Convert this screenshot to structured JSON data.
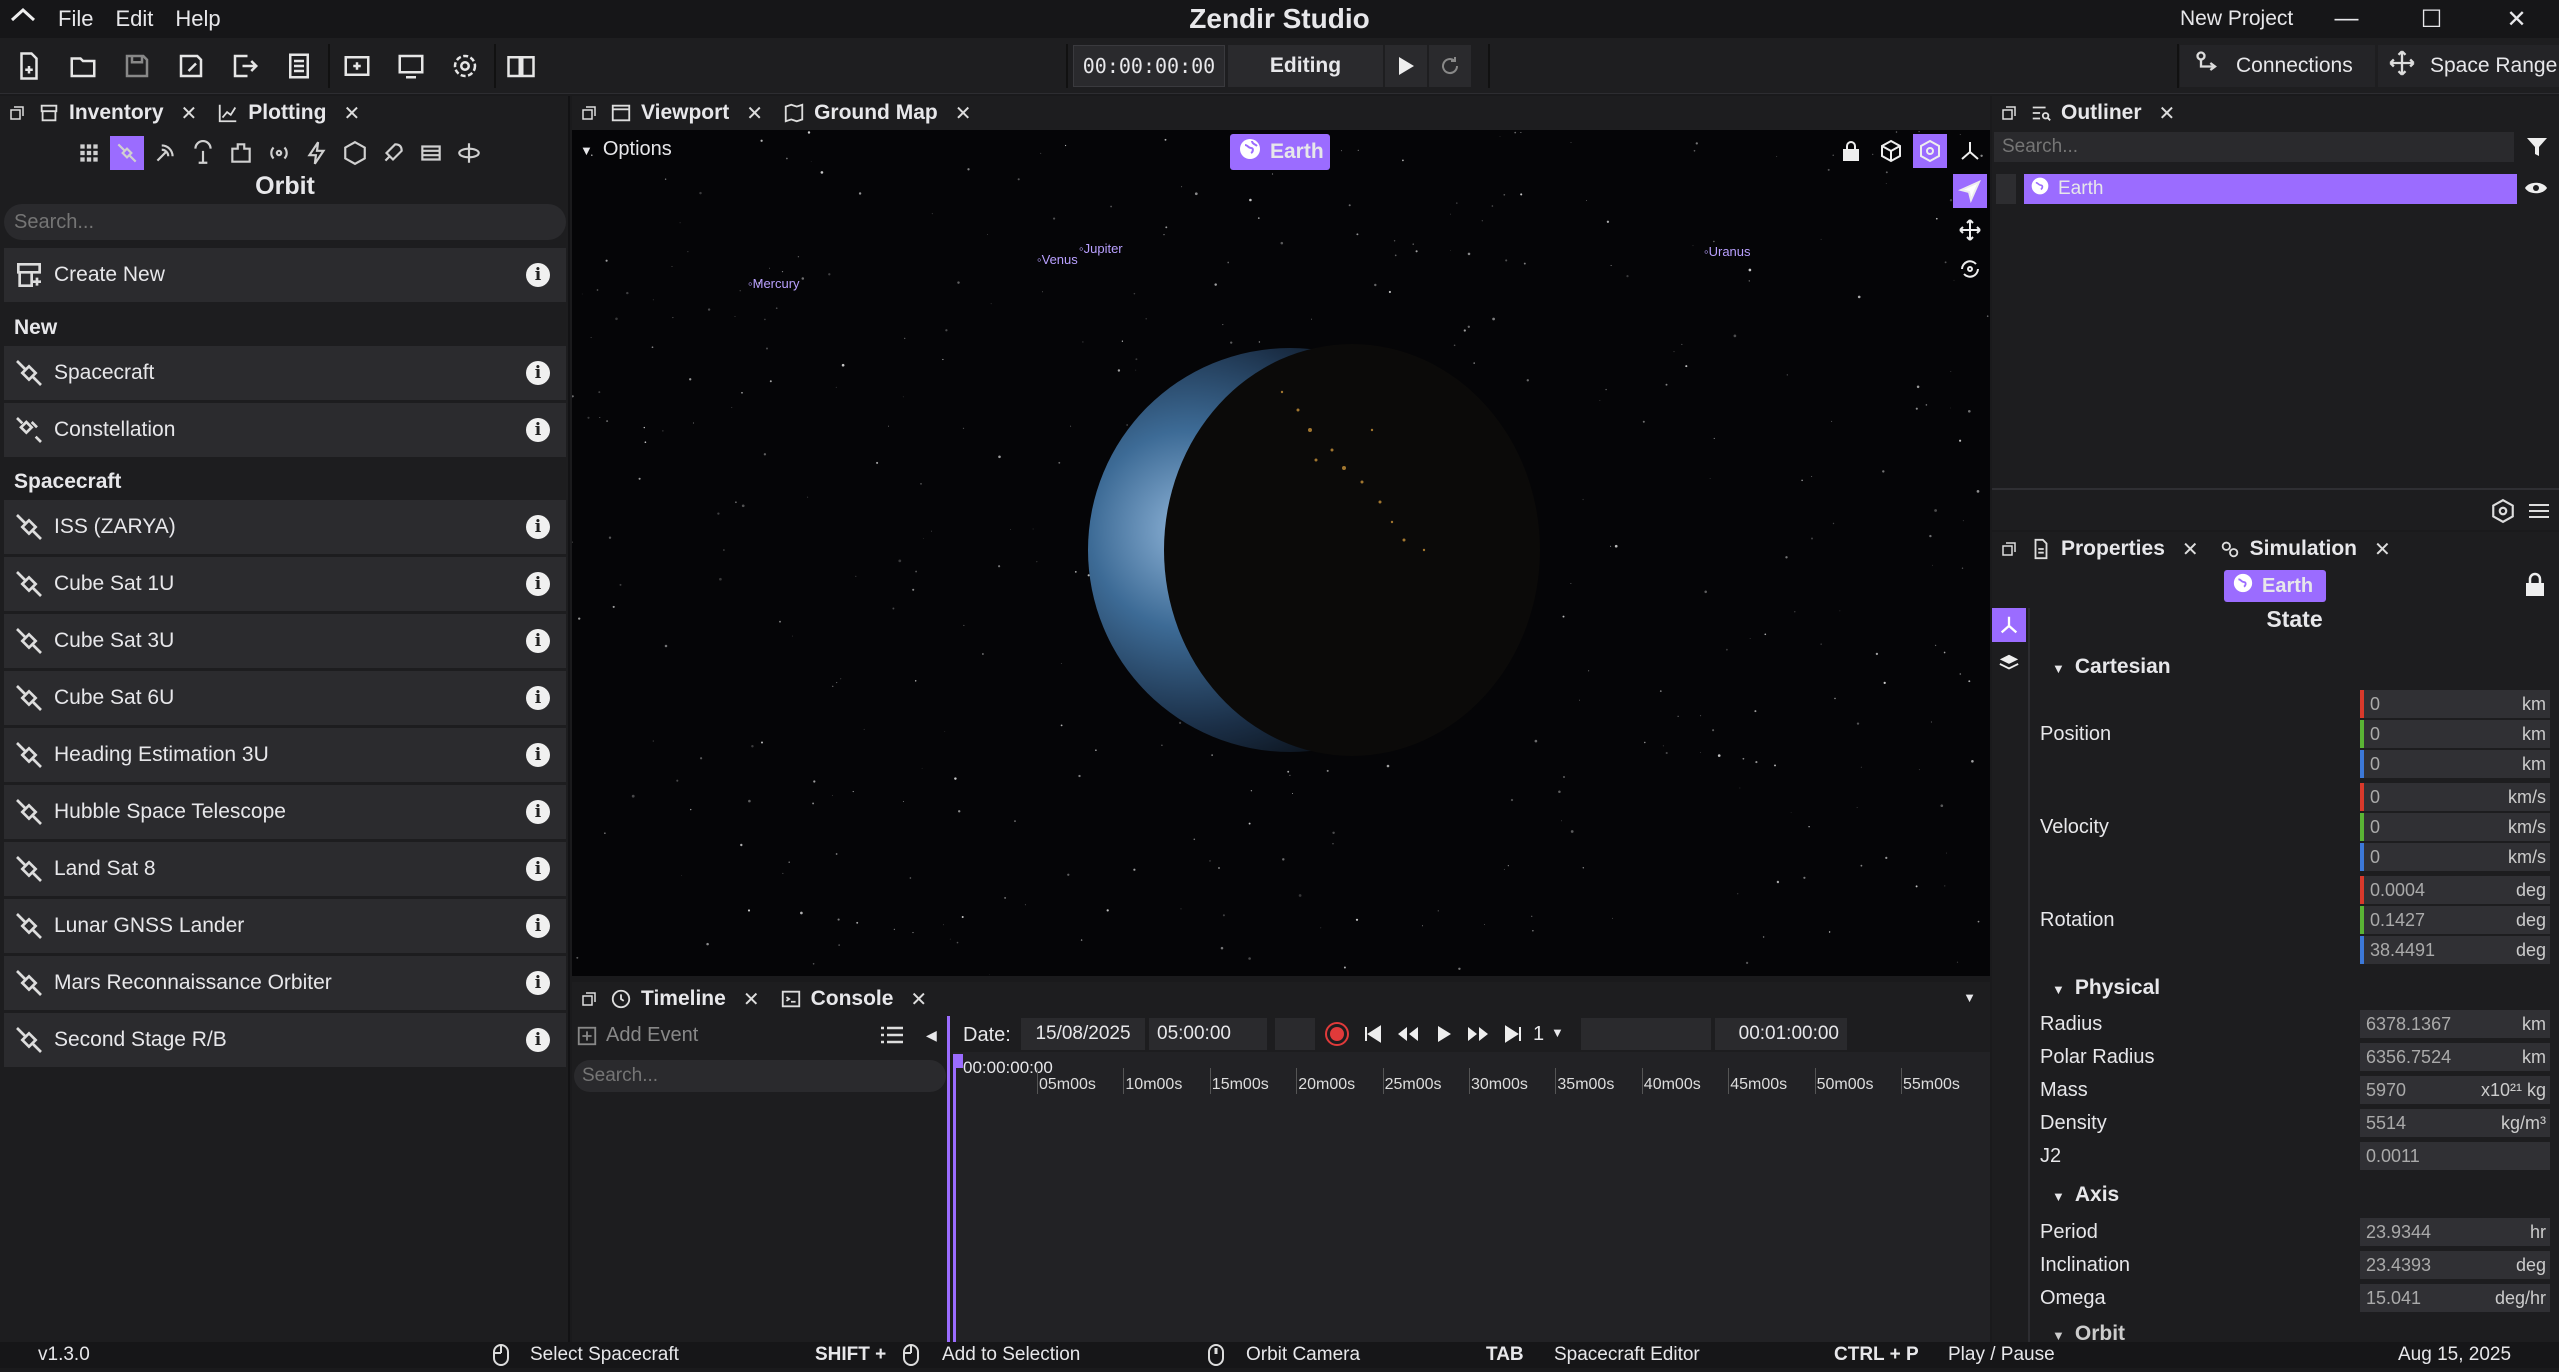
{
  "app": {
    "title": "Zendir Studio",
    "project": "New Project",
    "menu": [
      "File",
      "Edit",
      "Help"
    ],
    "window_buttons": [
      "—",
      "☐",
      "✕"
    ]
  },
  "toolbar": {
    "timecode": "00:00:00:00",
    "mode": "Editing",
    "connections": "Connections",
    "space_range": "Space Range"
  },
  "inventory": {
    "tabs": [
      "Inventory",
      "Plotting"
    ],
    "title": "Orbit",
    "search_placeholder": "Search...",
    "create_new": "Create New",
    "sections": [
      {
        "label": "New",
        "items": [
          "Spacecraft",
          "Constellation"
        ]
      },
      {
        "label": "Spacecraft",
        "items": [
          "ISS (ZARYA)",
          "Cube Sat 1U",
          "Cube Sat 3U",
          "Cube Sat 6U",
          "Heading Estimation 3U",
          "Hubble Space Telescope",
          "Land Sat 8",
          "Lunar GNSS Lander",
          "Mars Reconnaissance Orbiter",
          "Second Stage R/B"
        ]
      }
    ]
  },
  "viewport": {
    "tabs": [
      "Viewport",
      "Ground Map"
    ],
    "options": "Options",
    "focus": "Earth",
    "planets": [
      "Mercury",
      "Venus",
      "Jupiter",
      "Uranus"
    ]
  },
  "timeline": {
    "tabs": [
      "Timeline",
      "Console"
    ],
    "add_event": "Add Event",
    "search_placeholder": "Search...",
    "date_label": "Date:",
    "date": "15/08/2025",
    "time": "05:00:00",
    "speed": "1",
    "duration": "00:01:00:00",
    "cursor": "00:00:00:00",
    "ticks": [
      "05m00s",
      "10m00s",
      "15m00s",
      "20m00s",
      "25m00s",
      "30m00s",
      "35m00s",
      "40m00s",
      "45m00s",
      "50m00s",
      "55m00s"
    ]
  },
  "outliner": {
    "tab": "Outliner",
    "search_placeholder": "Search...",
    "items": [
      "Earth"
    ]
  },
  "properties": {
    "tabs": [
      "Properties",
      "Simulation"
    ],
    "object": "Earth",
    "heading": "State",
    "cartesian": {
      "label": "Cartesian",
      "position": {
        "label": "Position",
        "values": [
          "0",
          "0",
          "0"
        ],
        "unit": "km"
      },
      "velocity": {
        "label": "Velocity",
        "values": [
          "0",
          "0",
          "0"
        ],
        "unit": "km/s"
      },
      "rotation": {
        "label": "Rotation",
        "values": [
          "0.0004",
          "0.1427",
          "38.4491"
        ],
        "unit": "deg"
      }
    },
    "physical": {
      "label": "Physical",
      "rows": [
        {
          "label": "Radius",
          "value": "6378.1367",
          "unit": "km"
        },
        {
          "label": "Polar Radius",
          "value": "6356.7524",
          "unit": "km"
        },
        {
          "label": "Mass",
          "value": "5970",
          "unit": "x10²¹ kg"
        },
        {
          "label": "Density",
          "value": "5514",
          "unit": "kg/m³"
        },
        {
          "label": "J2",
          "value": "0.0011",
          "unit": ""
        }
      ]
    },
    "axis": {
      "label": "Axis",
      "rows": [
        {
          "label": "Period",
          "value": "23.9344",
          "unit": "hr"
        },
        {
          "label": "Inclination",
          "value": "23.4393",
          "unit": "deg"
        },
        {
          "label": "Omega",
          "value": "15.041",
          "unit": "deg/hr"
        }
      ]
    },
    "next_section": "Orbit"
  },
  "statusbar": {
    "version": "v1.3.0",
    "hint1": "Select Spacecraft",
    "key2": "SHIFT +",
    "hint2": "Add to Selection",
    "hint3": "Orbit Camera",
    "key4": "TAB",
    "hint4": "Spacecraft Editor",
    "key5": "CTRL + P",
    "hint5": "Play / Pause",
    "date": "Aug 15, 2025"
  },
  "colors": {
    "accent": "#9b6cff",
    "x_axis": "#d8392b",
    "y_axis": "#5ab334",
    "z_axis": "#3c78d8"
  }
}
